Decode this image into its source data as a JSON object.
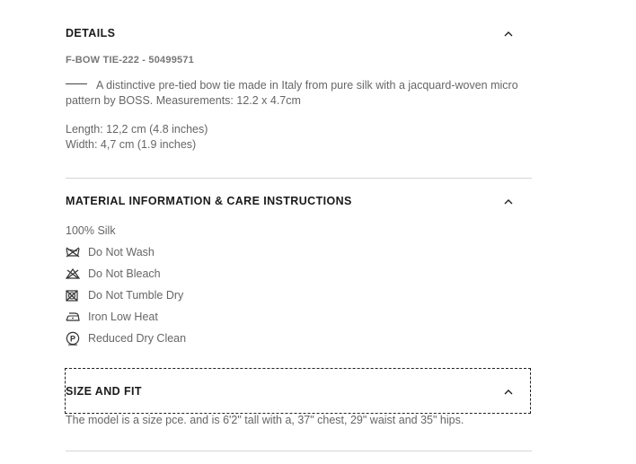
{
  "details": {
    "title": "DETAILS",
    "sku": "F-BOW TIE-222 - 50499571",
    "description": "A distinctive pre-tied bow tie made in Italy from pure silk with a jacquard-woven micro pattern by BOSS. Measurements: 12.2 x 4.7cm",
    "length": "Length: 12,2 cm (4.8 inches)",
    "width": "Width: 4,7 cm (1.9 inches)"
  },
  "material": {
    "title": "MATERIAL INFORMATION & CARE INSTRUCTIONS",
    "composition": "100% Silk",
    "care": [
      {
        "icon": "do-not-wash-icon",
        "label": "Do Not Wash"
      },
      {
        "icon": "do-not-bleach-icon",
        "label": "Do Not Bleach"
      },
      {
        "icon": "do-not-tumble-dry-icon",
        "label": "Do Not Tumble Dry"
      },
      {
        "icon": "iron-low-heat-icon",
        "label": "Iron Low Heat"
      },
      {
        "icon": "dry-clean-p-icon",
        "label": "Reduced Dry Clean"
      }
    ]
  },
  "size_fit": {
    "title": "SIZE AND FIT",
    "text": "The model is a size pce. and is 6'2\" tall with a, 37\" chest, 29\" waist and 35\" hips."
  }
}
